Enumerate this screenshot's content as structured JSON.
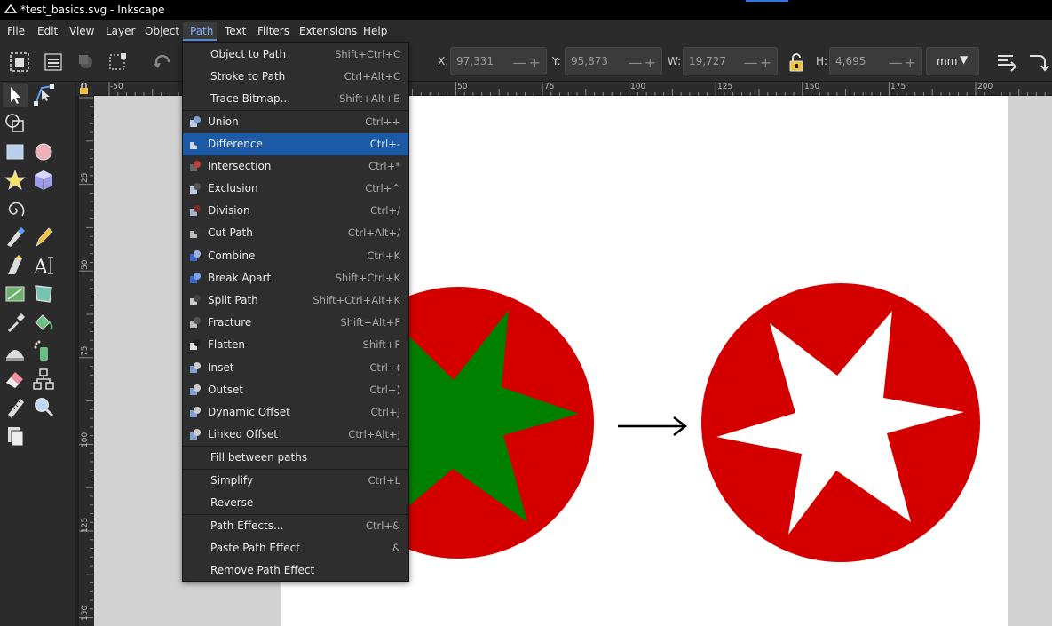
{
  "window": {
    "title": "*test_basics.svg - Inkscape"
  },
  "menubar": {
    "items": [
      {
        "label": "File"
      },
      {
        "label": "Edit"
      },
      {
        "label": "View"
      },
      {
        "label": "Layer"
      },
      {
        "label": "Object"
      },
      {
        "label": "Path"
      },
      {
        "label": "Text"
      },
      {
        "label": "Filters"
      },
      {
        "label": "Extensions"
      },
      {
        "label": "Help"
      }
    ]
  },
  "toolbar": {
    "x": {
      "label": "X:",
      "value": "97,331"
    },
    "y": {
      "label": "Y:",
      "value": "95,873"
    },
    "w": {
      "label": "W:",
      "value": "19,727"
    },
    "h": {
      "label": "H:",
      "value": "4,695"
    },
    "unit": "mm"
  },
  "ruler": {
    "h_ticks": [
      "-50",
      "50",
      "75",
      "100",
      "125",
      "150",
      "175",
      "200"
    ],
    "v_ticks": [
      "25",
      "50",
      "75",
      "100",
      "125",
      "150"
    ]
  },
  "path_menu": {
    "items": [
      {
        "label": "Object to Path",
        "shortcut": "Shift+Ctrl+C",
        "icon": ""
      },
      {
        "label": "Stroke to Path",
        "shortcut": "Ctrl+Alt+C",
        "icon": ""
      },
      {
        "label": "Trace Bitmap...",
        "shortcut": "Shift+Alt+B",
        "icon": ""
      },
      {
        "label": "Union",
        "shortcut": "Ctrl++",
        "icon": "union-icon"
      },
      {
        "label": "Difference",
        "shortcut": "Ctrl+-",
        "icon": "difference-icon"
      },
      {
        "label": "Intersection",
        "shortcut": "Ctrl+*",
        "icon": "intersection-icon"
      },
      {
        "label": "Exclusion",
        "shortcut": "Ctrl+^",
        "icon": "exclusion-icon"
      },
      {
        "label": "Division",
        "shortcut": "Ctrl+/",
        "icon": "division-icon"
      },
      {
        "label": "Cut Path",
        "shortcut": "Ctrl+Alt+/",
        "icon": "cut-path-icon"
      },
      {
        "label": "Combine",
        "shortcut": "Ctrl+K",
        "icon": "combine-icon"
      },
      {
        "label": "Break Apart",
        "shortcut": "Shift+Ctrl+K",
        "icon": "break-apart-icon"
      },
      {
        "label": "Split Path",
        "shortcut": "Shift+Ctrl+Alt+K",
        "icon": "split-path-icon"
      },
      {
        "label": "Fracture",
        "shortcut": "Shift+Alt+F",
        "icon": "fracture-icon"
      },
      {
        "label": "Flatten",
        "shortcut": "Shift+F",
        "icon": "flatten-icon"
      },
      {
        "label": "Inset",
        "shortcut": "Ctrl+(",
        "icon": "inset-icon"
      },
      {
        "label": "Outset",
        "shortcut": "Ctrl+)",
        "icon": "outset-icon"
      },
      {
        "label": "Dynamic Offset",
        "shortcut": "Ctrl+J",
        "icon": "dynamic-offset-icon"
      },
      {
        "label": "Linked Offset",
        "shortcut": "Ctrl+Alt+J",
        "icon": "linked-offset-icon"
      },
      {
        "label": "Fill between paths",
        "shortcut": "",
        "icon": ""
      },
      {
        "label": "Simplify",
        "shortcut": "Ctrl+L",
        "icon": ""
      },
      {
        "label": "Reverse",
        "shortcut": "",
        "icon": ""
      },
      {
        "label": "Path Effects...",
        "shortcut": "Ctrl+&",
        "icon": ""
      },
      {
        "label": "Paste Path Effect",
        "shortcut": "&",
        "icon": ""
      },
      {
        "label": "Remove Path Effect",
        "shortcut": "",
        "icon": ""
      }
    ],
    "highlighted": "Difference"
  },
  "colors": {
    "circle_red": "#d40000",
    "star_green": "#008000",
    "menu_highlight": "#1c5aa6"
  }
}
